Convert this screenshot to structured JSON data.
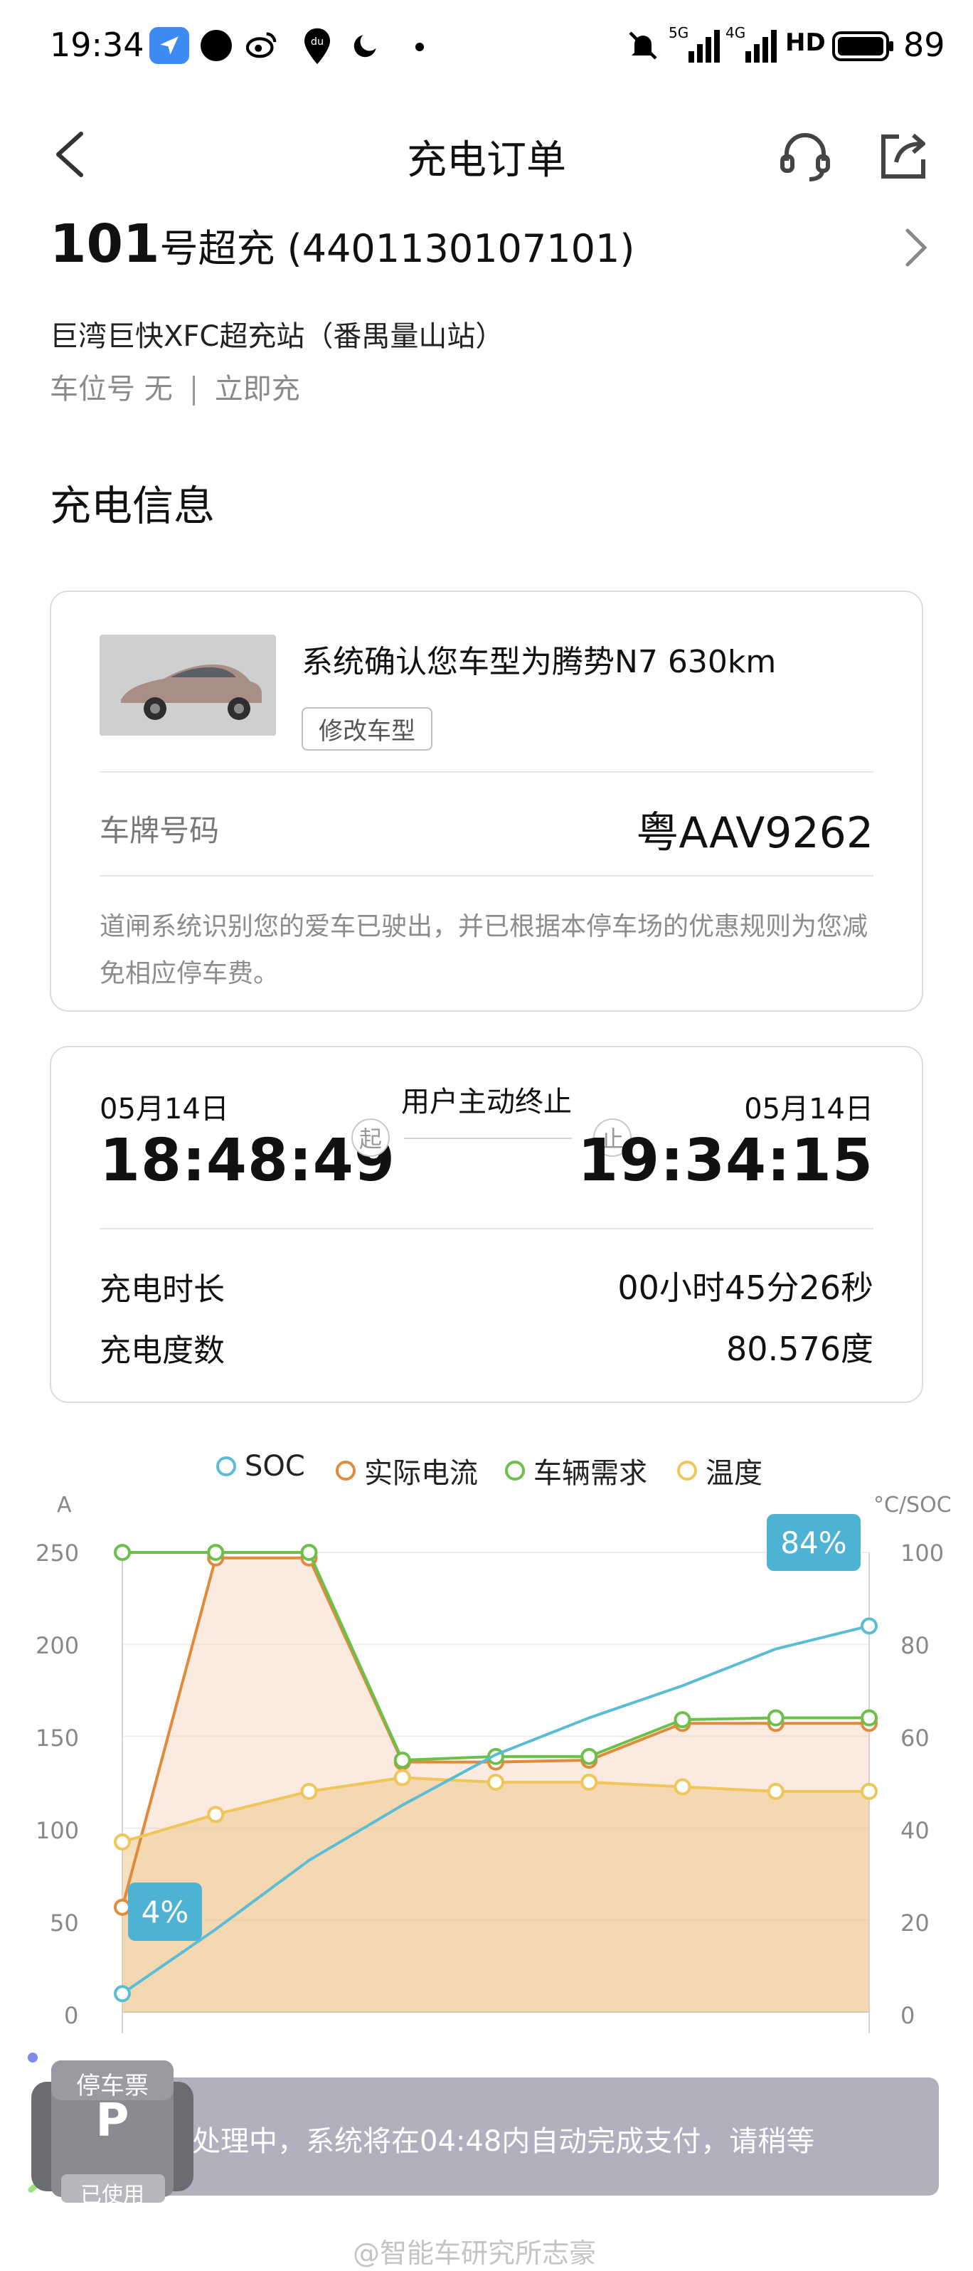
{
  "status_bar": {
    "time": "19:34",
    "network_5g": "5G",
    "network_4g": "4G",
    "hd": "HD",
    "battery": "89"
  },
  "header": {
    "title": "充电订单"
  },
  "station": {
    "pile_number": "101",
    "pile_suffix": "号超充",
    "pile_id": "(4401130107101)",
    "name": "巨湾巨快XFC超充站（番禺量山站）",
    "slot_label": "车位号 无",
    "mode": "立即充"
  },
  "section_title": "充电信息",
  "vehicle": {
    "confirm_text": "系统确认您车型为腾势N7 630km",
    "change_model_label": "修改车型",
    "plate_label": "车牌号码",
    "plate_value": "粤AAV9262",
    "notice": "道闸系统识别您的爱车已驶出，并已根据本停车场的优惠规则为您减免相应停车费。"
  },
  "session": {
    "start_date": "05月14日",
    "start_time": "18:48:49",
    "end_date": "05月14日",
    "end_time": "19:34:15",
    "end_reason": "用户主动终止",
    "start_marker": "起",
    "end_marker": "止",
    "duration_label": "充电时长",
    "duration_value": "00小时45分26秒",
    "energy_label": "充电度数",
    "energy_value": "80.576度"
  },
  "chart_data": {
    "type": "line",
    "title": "",
    "legend": [
      {
        "name": "SOC",
        "color": "#5bbcd6"
      },
      {
        "name": "实际电流",
        "color": "#e08a3c"
      },
      {
        "name": "车辆需求",
        "color": "#6cc04a"
      },
      {
        "name": "温度",
        "color": "#f0c65a"
      }
    ],
    "legend_position": "top",
    "y_left": {
      "unit": "A",
      "range": [
        0,
        250
      ],
      "ticks": [
        "250",
        "200",
        "150",
        "100",
        "50",
        "0"
      ]
    },
    "y_right": {
      "unit": "°C/SOC",
      "range": [
        0,
        100
      ],
      "ticks": [
        "100",
        "80",
        "60",
        "40",
        "20",
        "0"
      ]
    },
    "x": [
      0,
      1,
      2,
      3,
      4,
      5,
      6,
      7,
      8
    ],
    "series": [
      {
        "name": "SOC",
        "axis": "right",
        "values": [
          4,
          18,
          33,
          45,
          56,
          64,
          71,
          79,
          84
        ]
      },
      {
        "name": "实际电流",
        "axis": "left",
        "values": [
          57,
          247,
          247,
          136,
          136,
          137,
          157,
          157,
          157
        ]
      },
      {
        "name": "车辆需求",
        "axis": "left",
        "values": [
          250,
          250,
          250,
          137,
          139,
          139,
          159,
          160,
          160
        ]
      },
      {
        "name": "温度",
        "axis": "right",
        "values": [
          37,
          43,
          48,
          51,
          50,
          50,
          49,
          48,
          48
        ]
      }
    ],
    "annotations": [
      {
        "label": "4%",
        "series": "SOC",
        "x": 0
      },
      {
        "label": "84%",
        "series": "SOC",
        "x": 8
      }
    ],
    "grid": true
  },
  "payment": {
    "status_text": "处理中，系统将在04:48内自动完成支付，请稍等"
  },
  "parking_ticket": {
    "title": "停车票",
    "used_label": "已使用"
  },
  "watermark": "@智能车研究所志豪"
}
